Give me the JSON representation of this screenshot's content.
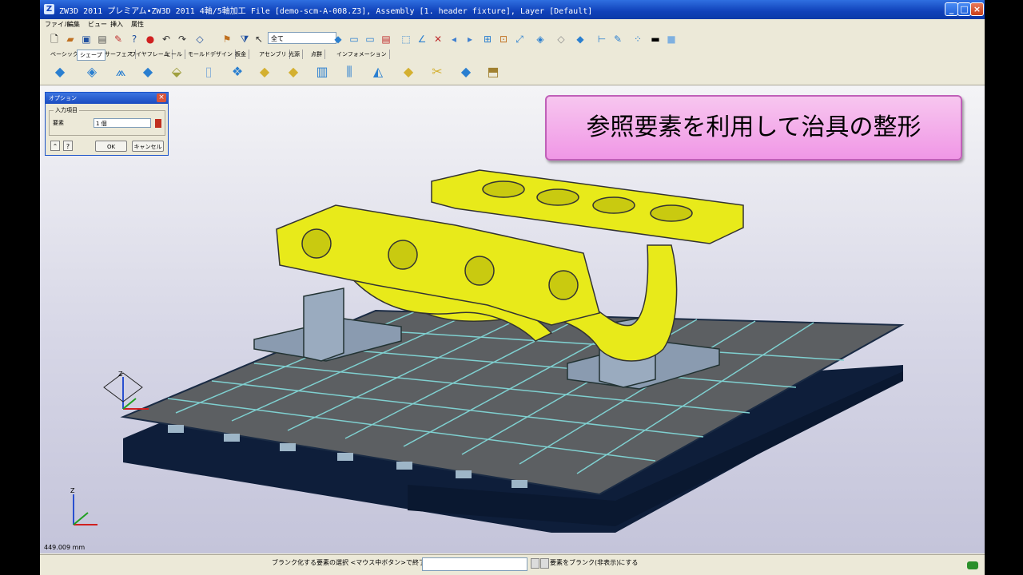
{
  "window": {
    "title": "ZW3D 2011 プレミアム•ZW3D 2011 4軸/5軸加工    File [demo-scm-A-008.Z3], Assembly [1. header fixture], Layer [Default]"
  },
  "menu": [
    "ファイル",
    "編集",
    "ビュー",
    "挿入",
    "属性"
  ],
  "toolbar": {
    "filter_value": "全て"
  },
  "tabs": [
    {
      "label": "ベーシック"
    },
    {
      "label": "シェープ",
      "active": true
    },
    {
      "label": "サーフェス"
    },
    {
      "label": "ワイヤフレーム"
    },
    {
      "label": "ヒール"
    },
    {
      "label": "モールドデザイン"
    },
    {
      "label": "板金"
    },
    {
      "label": "アセンブリ"
    },
    {
      "label": "光源"
    },
    {
      "label": "点群"
    },
    {
      "label": "インフォメーション"
    }
  ],
  "options_panel": {
    "title": "オプション",
    "group_label": "入力項目",
    "field_label": "要素",
    "field_value": "1 個",
    "ok_label": "OK",
    "cancel_label": "キャンセル"
  },
  "banner": {
    "text": "参照要素を利用して治具の整形"
  },
  "viewport": {
    "axis_label": "Z",
    "coord_readout": "449.009 mm"
  },
  "status": {
    "prompt": "ブランク化する要素の選択 <マウス中ボタン>で終了",
    "hint": "要素をブランク(非表示)にする"
  },
  "colors": {
    "part": "#e8ea1a",
    "fixture": "#8a9bb0",
    "table_top": "#5c5f62",
    "table_base": "#0e1e3a",
    "banner": "#f097e6"
  }
}
